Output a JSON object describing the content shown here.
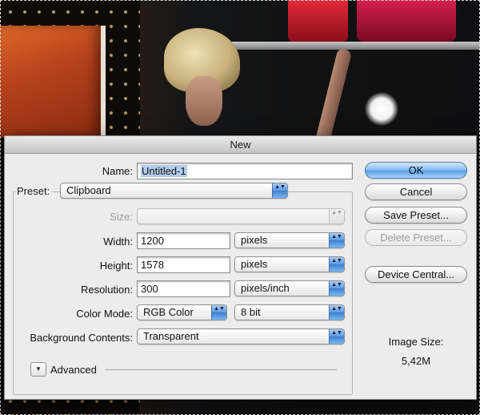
{
  "dialog": {
    "title": "New"
  },
  "form": {
    "name": {
      "label": "Name:",
      "value": "Untitled-1"
    },
    "preset": {
      "label": "Preset:",
      "value": "Clipboard"
    },
    "size": {
      "label": "Size:",
      "value": ""
    },
    "width": {
      "label": "Width:",
      "value": "1200",
      "unit": "pixels"
    },
    "height": {
      "label": "Height:",
      "value": "1578",
      "unit": "pixels"
    },
    "resolution": {
      "label": "Resolution:",
      "value": "300",
      "unit": "pixels/inch"
    },
    "color_mode": {
      "label": "Color Mode:",
      "value": "RGB Color",
      "depth": "8 bit"
    },
    "background": {
      "label": "Background Contents:",
      "value": "Transparent"
    },
    "advanced": {
      "label": "Advanced"
    }
  },
  "buttons": {
    "ok": "OK",
    "cancel": "Cancel",
    "save_preset": "Save Preset...",
    "delete_preset": "Delete Preset...",
    "device_central": "Device Central..."
  },
  "image_size": {
    "label": "Image Size:",
    "value": "5,42M"
  },
  "icons": {
    "popup_arrows": "▲▼",
    "disclosure": "▼"
  }
}
